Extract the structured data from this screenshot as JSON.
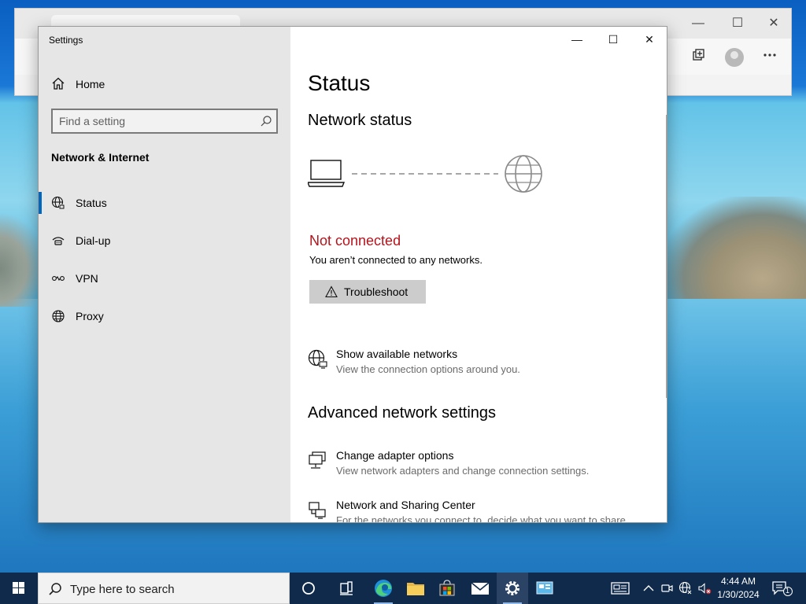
{
  "settings_window": {
    "title": "Settings",
    "controls": {
      "minimize": "—",
      "maximize": "☐",
      "close": "✕"
    }
  },
  "nav": {
    "home_label": "Home",
    "search_placeholder": "Find a setting",
    "section_title": "Network & Internet",
    "items": [
      {
        "label": "Status",
        "icon": "status-globe-icon",
        "active": true
      },
      {
        "label": "Dial-up",
        "icon": "dial-up-icon",
        "active": false
      },
      {
        "label": "VPN",
        "icon": "vpn-icon",
        "active": false
      },
      {
        "label": "Proxy",
        "icon": "proxy-globe-icon",
        "active": false
      }
    ]
  },
  "content": {
    "page_title": "Status",
    "network_status_heading": "Network status",
    "status_text": "Not connected",
    "status_color": "#b3141c",
    "status_description": "You aren’t connected to any networks.",
    "troubleshoot_label": "Troubleshoot",
    "show_networks": {
      "title": "Show available networks",
      "subtitle": "View the connection options around you."
    },
    "advanced_heading": "Advanced network settings",
    "change_adapter": {
      "title": "Change adapter options",
      "subtitle": "View network adapters and change connection settings."
    },
    "sharing_center": {
      "title": "Network and Sharing Center",
      "subtitle": "For the networks you connect to, decide what you want to share."
    }
  },
  "taskbar": {
    "search_placeholder": "Type here to search",
    "apps": [
      "cortana-icon",
      "task-view-icon",
      "edge-icon",
      "file-explorer-icon",
      "store-icon",
      "mail-icon",
      "settings-gear-icon",
      "control-panel-icon"
    ],
    "clock": {
      "time": "4:44 AM",
      "date": "1/30/2024"
    },
    "notification_count": "1"
  },
  "browser_background": {
    "window_controls": {
      "minimize": "—",
      "maximize": "☐",
      "close": "✕"
    }
  },
  "colors": {
    "accent": "#0067c0",
    "taskbar": "#0f2a4a",
    "nav_pane": "#e6e6e6",
    "error_red": "#b3141c"
  }
}
